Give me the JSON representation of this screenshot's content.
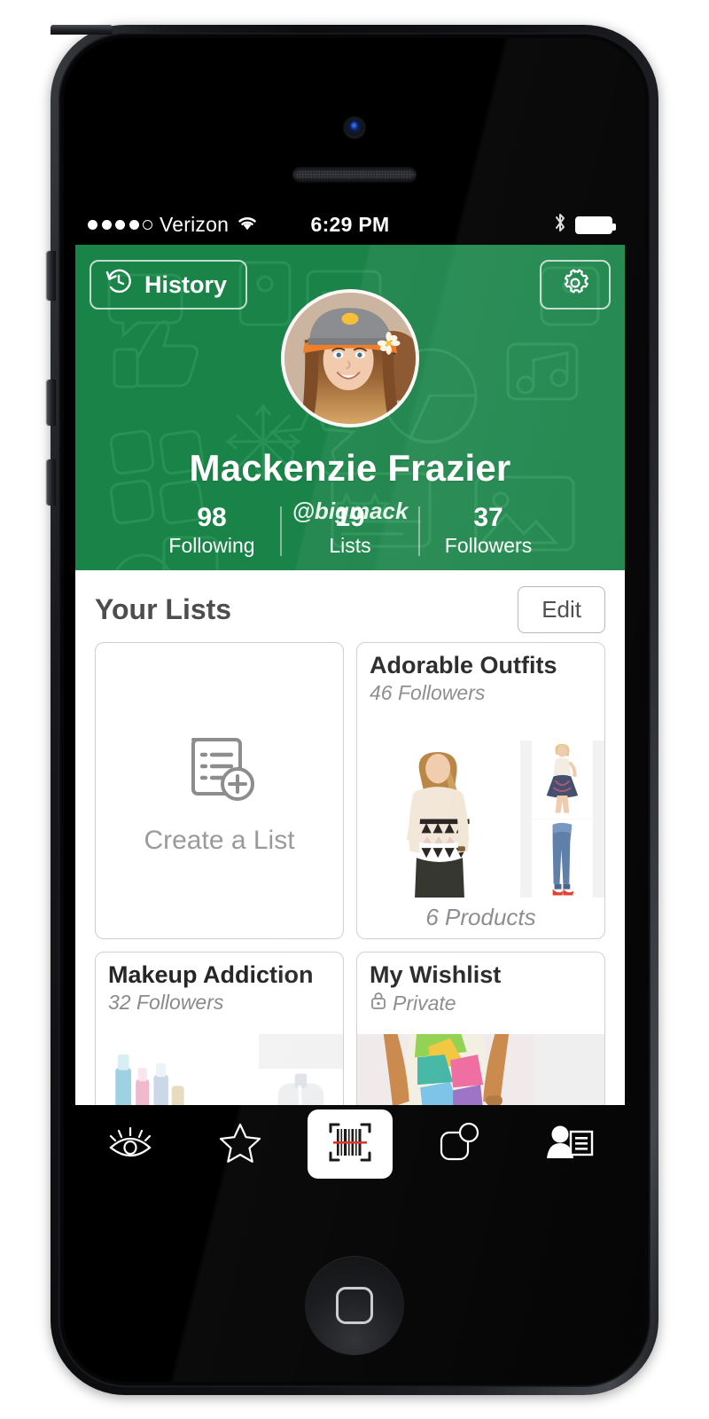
{
  "device": {
    "model_label": "iPhone"
  },
  "status_bar": {
    "signal_dots_filled": 4,
    "signal_dots_total": 5,
    "carrier": "Verizon",
    "wifi_icon": "wifi-icon",
    "time": "6:29 PM",
    "bluetooth_icon": "bluetooth-icon",
    "battery_icon": "battery-full-icon"
  },
  "header": {
    "history_label": "History",
    "history_icon": "history-clock-icon",
    "settings_icon": "gear-icon",
    "display_name": "Mackenzie Frazier",
    "handle": "@bigmack",
    "background_color": "#1a8348",
    "stats": [
      {
        "value": "98",
        "label": "Following"
      },
      {
        "value": "19",
        "label": "Lists"
      },
      {
        "value": "37",
        "label": "Followers"
      }
    ]
  },
  "lists": {
    "section_title": "Your Lists",
    "edit_label": "Edit",
    "create_card": {
      "label": "Create a List",
      "icon": "list-add-icon"
    },
    "cards": [
      {
        "title": "Adorable Outfits",
        "subtitle": "46 Followers",
        "private": false,
        "footer": "6 Products"
      },
      {
        "title": "Makeup Addiction",
        "subtitle": "32 Followers",
        "private": false,
        "footer": ""
      },
      {
        "title": "My Wishlist",
        "subtitle": "Private",
        "private": true,
        "lock_icon": "lock-icon",
        "footer": ""
      }
    ]
  },
  "tab_bar": {
    "background_color": "#000000",
    "items": [
      {
        "name": "tab-feed",
        "icon": "eye-icon",
        "active": false
      },
      {
        "name": "tab-favorites",
        "icon": "star-icon",
        "active": false
      },
      {
        "name": "tab-scan",
        "icon": "barcode-scan-icon",
        "active": true
      },
      {
        "name": "tab-tags",
        "icon": "tag-square-icon",
        "active": false
      },
      {
        "name": "tab-profile",
        "icon": "person-list-icon",
        "active": true
      }
    ]
  }
}
